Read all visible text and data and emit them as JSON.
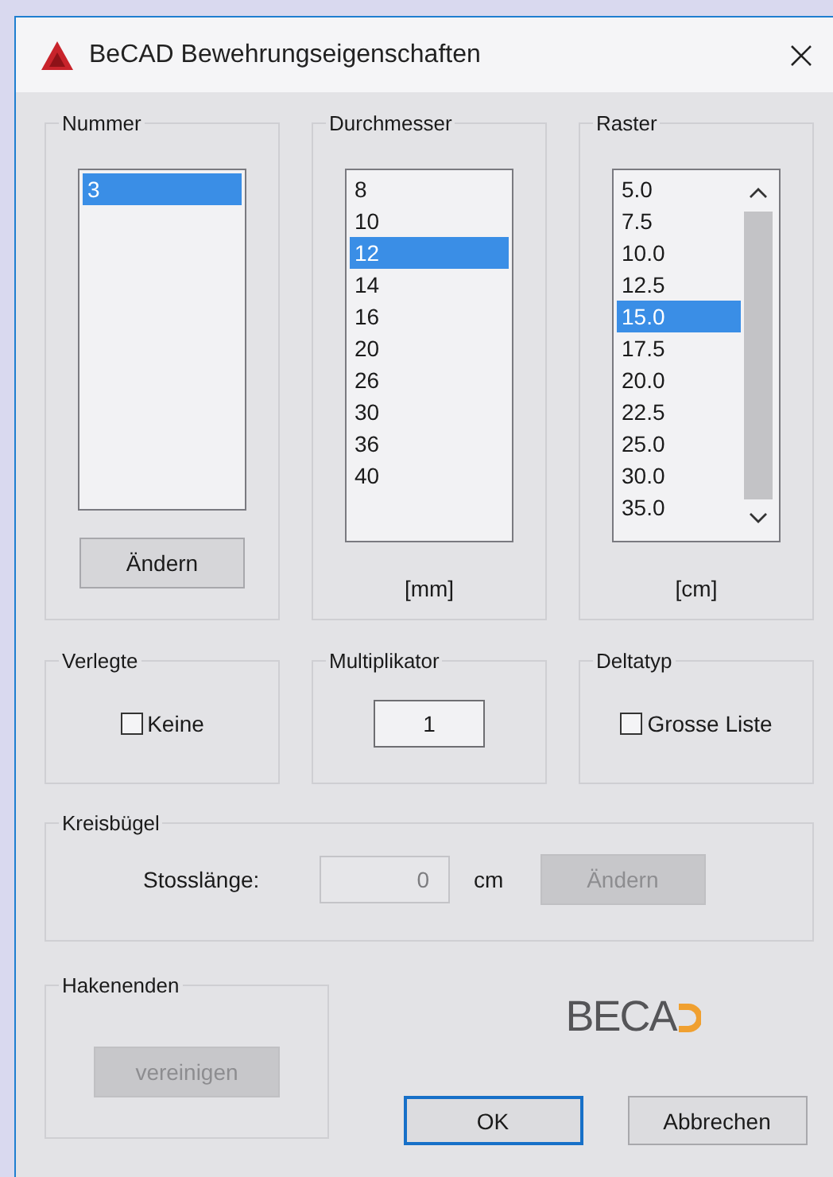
{
  "window": {
    "title": "BeCAD Bewehrungseigenschaften"
  },
  "nummer": {
    "label": "Nummer",
    "items": [
      {
        "text": "3",
        "selected": true
      }
    ],
    "button": {
      "label": "Ändern",
      "disabled": false
    }
  },
  "durchmesser": {
    "label": "Durchmesser",
    "items": [
      {
        "text": "8",
        "selected": false
      },
      {
        "text": "10",
        "selected": false
      },
      {
        "text": "12",
        "selected": true
      },
      {
        "text": "14",
        "selected": false
      },
      {
        "text": "16",
        "selected": false
      },
      {
        "text": "20",
        "selected": false
      },
      {
        "text": "26",
        "selected": false
      },
      {
        "text": "30",
        "selected": false
      },
      {
        "text": "36",
        "selected": false
      },
      {
        "text": "40",
        "selected": false
      }
    ],
    "unit": "[mm]"
  },
  "raster": {
    "label": "Raster",
    "items": [
      {
        "text": "5.0",
        "selected": false
      },
      {
        "text": "7.5",
        "selected": false
      },
      {
        "text": "10.0",
        "selected": false
      },
      {
        "text": "12.5",
        "selected": false
      },
      {
        "text": "15.0",
        "selected": true
      },
      {
        "text": "17.5",
        "selected": false
      },
      {
        "text": "20.0",
        "selected": false
      },
      {
        "text": "22.5",
        "selected": false
      },
      {
        "text": "25.0",
        "selected": false
      },
      {
        "text": "30.0",
        "selected": false
      },
      {
        "text": "35.0",
        "selected": false
      }
    ],
    "unit": "[cm]"
  },
  "verlegte": {
    "label": "Verlegte",
    "checkbox": {
      "label": "Keine",
      "checked": false
    }
  },
  "multiplikator": {
    "label": "Multiplikator",
    "value": "1"
  },
  "deltatyp": {
    "label": "Deltatyp",
    "checkbox": {
      "label": "Grosse Liste",
      "checked": false
    }
  },
  "kreisbuegel": {
    "label": "Kreisbügel",
    "field_label": "Stosslänge:",
    "value": "0",
    "disabled": true,
    "unit": "cm",
    "button": {
      "label": "Ändern",
      "disabled": true
    }
  },
  "hakenenden": {
    "label": "Hakenenden",
    "button": {
      "label": "vereinigen",
      "disabled": true
    }
  },
  "logo": {
    "text": "BECA"
  },
  "buttons": [
    {
      "label": "OK",
      "default": true
    },
    {
      "label": "Abbrechen",
      "default": false
    }
  ]
}
